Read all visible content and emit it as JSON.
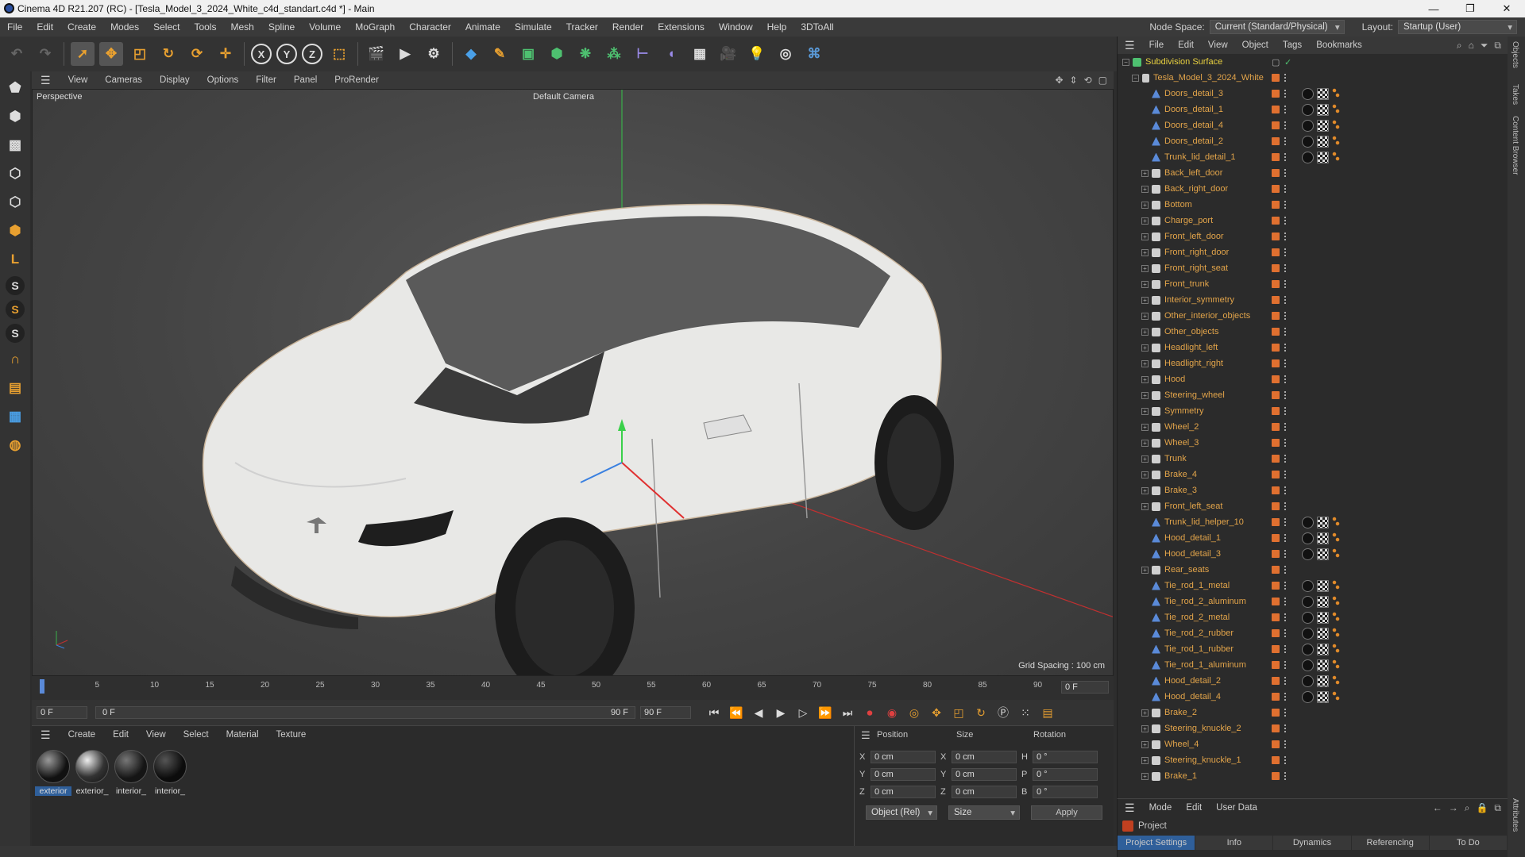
{
  "window": {
    "title": "Cinema 4D R21.207 (RC) - [Tesla_Model_3_2024_White_c4d_standart.c4d *] - Main",
    "minimize": "—",
    "maximize": "❐",
    "close": "✕"
  },
  "menu": {
    "items": [
      "File",
      "Edit",
      "Create",
      "Modes",
      "Select",
      "Tools",
      "Mesh",
      "Spline",
      "Volume",
      "MoGraph",
      "Character",
      "Animate",
      "Simulate",
      "Tracker",
      "Render",
      "Extensions",
      "Window",
      "Help",
      "3DToAll"
    ],
    "node_space_label": "Node Space:",
    "node_space_value": "Current (Standard/Physical)",
    "layout_label": "Layout:",
    "layout_value": "Startup (User)"
  },
  "viewport": {
    "menu": [
      "View",
      "Cameras",
      "Display",
      "Options",
      "Filter",
      "Panel",
      "ProRender"
    ],
    "label": "Perspective",
    "camera": "Default Camera",
    "grid_spacing": "Grid Spacing : 100 cm"
  },
  "timeline": {
    "ticks": [
      "0",
      "5",
      "10",
      "15",
      "20",
      "25",
      "30",
      "35",
      "40",
      "45",
      "50",
      "55",
      "60",
      "65",
      "70",
      "75",
      "80",
      "85",
      "90"
    ],
    "current": "0 F"
  },
  "transport": {
    "start": "0 F",
    "range_start": "0 F",
    "range_end": "90 F",
    "end": "90 F"
  },
  "materials": {
    "menu": [
      "Create",
      "Edit",
      "View",
      "Select",
      "Material",
      "Texture"
    ],
    "items": [
      "exterior",
      "exterior_",
      "interior_",
      "interior_"
    ]
  },
  "coords": {
    "headers": [
      "Position",
      "Size",
      "Rotation"
    ],
    "rows": [
      {
        "axis": "X",
        "pos": "0 cm",
        "saxis": "X",
        "size": "0 cm",
        "raxis": "H",
        "rot": "0 °"
      },
      {
        "axis": "Y",
        "pos": "0 cm",
        "saxis": "Y",
        "size": "0 cm",
        "raxis": "P",
        "rot": "0 °"
      },
      {
        "axis": "Z",
        "pos": "0 cm",
        "saxis": "Z",
        "size": "0 cm",
        "raxis": "B",
        "rot": "0 °"
      }
    ],
    "mode": "Object (Rel)",
    "size_mode": "Size",
    "apply": "Apply"
  },
  "objects": {
    "menu": [
      "File",
      "Edit",
      "View",
      "Object",
      "Tags",
      "Bookmarks"
    ],
    "root": "Subdivision Surface",
    "group": "Tesla_Model_3_2024_White",
    "items": [
      {
        "name": "Doors_detail_3",
        "kind": "mesh",
        "tags": true
      },
      {
        "name": "Doors_detail_1",
        "kind": "mesh",
        "tags": true
      },
      {
        "name": "Doors_detail_4",
        "kind": "mesh",
        "tags": true
      },
      {
        "name": "Doors_detail_2",
        "kind": "mesh",
        "tags": true
      },
      {
        "name": "Trunk_lid_detail_1",
        "kind": "mesh",
        "tags": true
      },
      {
        "name": "Back_left_door",
        "kind": "null",
        "tags": false
      },
      {
        "name": "Back_right_door",
        "kind": "null",
        "tags": false
      },
      {
        "name": "Bottom",
        "kind": "null",
        "tags": false
      },
      {
        "name": "Charge_port",
        "kind": "null",
        "tags": false
      },
      {
        "name": "Front_left_door",
        "kind": "null",
        "tags": false
      },
      {
        "name": "Front_right_door",
        "kind": "null",
        "tags": false
      },
      {
        "name": "Front_right_seat",
        "kind": "null",
        "tags": false
      },
      {
        "name": "Front_trunk",
        "kind": "null",
        "tags": false
      },
      {
        "name": "Interior_symmetry",
        "kind": "null",
        "tags": false
      },
      {
        "name": "Other_interior_objects",
        "kind": "null",
        "tags": false
      },
      {
        "name": "Other_objects",
        "kind": "null",
        "tags": false
      },
      {
        "name": "Headlight_left",
        "kind": "null",
        "tags": false
      },
      {
        "name": "Headlight_right",
        "kind": "null",
        "tags": false
      },
      {
        "name": "Hood",
        "kind": "null",
        "tags": false
      },
      {
        "name": "Steering_wheel",
        "kind": "null",
        "tags": false
      },
      {
        "name": "Symmetry",
        "kind": "null",
        "tags": false
      },
      {
        "name": "Wheel_2",
        "kind": "null",
        "tags": false
      },
      {
        "name": "Wheel_3",
        "kind": "null",
        "tags": false
      },
      {
        "name": "Trunk",
        "kind": "null",
        "tags": false
      },
      {
        "name": "Brake_4",
        "kind": "null",
        "tags": false
      },
      {
        "name": "Brake_3",
        "kind": "null",
        "tags": false
      },
      {
        "name": "Front_left_seat",
        "kind": "null",
        "tags": false
      },
      {
        "name": "Trunk_lid_helper_10",
        "kind": "mesh",
        "tags": true
      },
      {
        "name": "Hood_detail_1",
        "kind": "mesh",
        "tags": true
      },
      {
        "name": "Hood_detail_3",
        "kind": "mesh",
        "tags": true
      },
      {
        "name": "Rear_seats",
        "kind": "null",
        "tags": false
      },
      {
        "name": "Tie_rod_1_metal",
        "kind": "mesh",
        "tags": true
      },
      {
        "name": "Tie_rod_2_aluminum",
        "kind": "mesh",
        "tags": true
      },
      {
        "name": "Tie_rod_2_metal",
        "kind": "mesh",
        "tags": true
      },
      {
        "name": "Tie_rod_2_rubber",
        "kind": "mesh",
        "tags": true
      },
      {
        "name": "Tie_rod_1_rubber",
        "kind": "mesh",
        "tags": true
      },
      {
        "name": "Tie_rod_1_aluminum",
        "kind": "mesh",
        "tags": true
      },
      {
        "name": "Hood_detail_2",
        "kind": "mesh",
        "tags": true
      },
      {
        "name": "Hood_detail_4",
        "kind": "mesh",
        "tags": true
      },
      {
        "name": "Brake_2",
        "kind": "null",
        "tags": false
      },
      {
        "name": "Steering_knuckle_2",
        "kind": "null",
        "tags": false
      },
      {
        "name": "Wheel_4",
        "kind": "null",
        "tags": false
      },
      {
        "name": "Steering_knuckle_1",
        "kind": "null",
        "tags": false
      },
      {
        "name": "Brake_1",
        "kind": "null",
        "tags": false
      }
    ]
  },
  "attributes": {
    "menu": [
      "Mode",
      "Edit",
      "User Data"
    ],
    "project": "Project",
    "tabs": [
      "Project Settings",
      "Info",
      "Dynamics",
      "Referencing",
      "To Do"
    ]
  },
  "side_tabs": [
    "Objects",
    "Takes",
    "Content Browser",
    "Attributes"
  ],
  "colors": {
    "accent": "#e2a44a",
    "swatch": "#e07030",
    "selected_tab": "#2f5f9a"
  }
}
